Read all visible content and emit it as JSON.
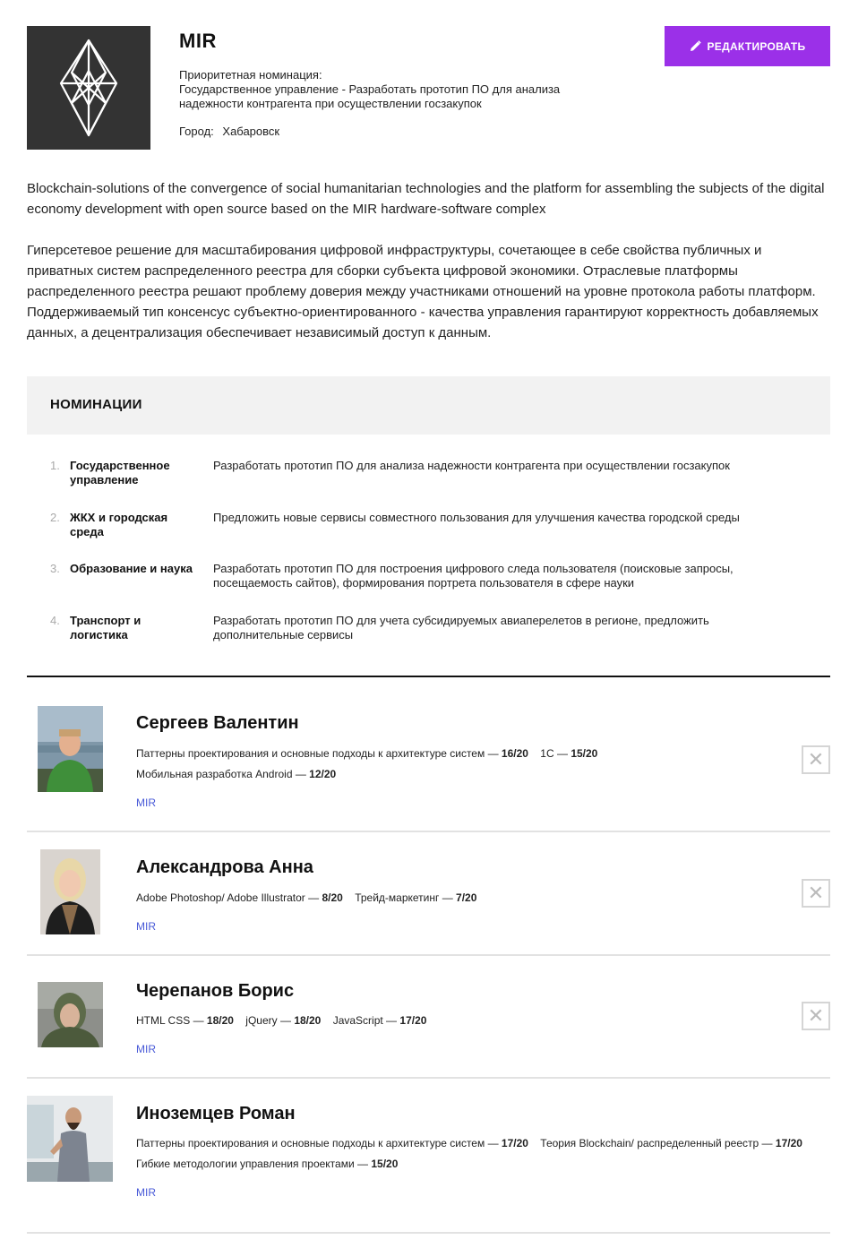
{
  "team": {
    "name": "MIR",
    "priority_label": "Приоритетная номинация:",
    "priority_value": "Государственное управление - Разработать прототип ПО для анализа надежности контрагента при осуществлении госзакупок",
    "city_label": "Город:",
    "city_value": "Хабаровск",
    "edit_label": "РЕДАКТИРОВАТЬ"
  },
  "description": {
    "en": "Blockchain-solutions of the convergence of social humanitarian technologies and the platform for assembling the subjects of the digital economy development with open source based on the MIR hardware-software complex",
    "ru": "Гиперсетевое решение для масштабирования цифровой инфраструктуры, сочетающее в себе свойства публичных и приватных систем распределенного реестра для сборки субъекта цифровой экономики. Отраслевые платформы распределенного реестра решают проблему доверия между участниками отношений на уровне протокола работы платформ. Поддерживаемый тип консенсус субъектно-ориентированного - качества управления гарантируют корректность добавляемых данных, а децентрализация обеспечивает независимый доступ к данным."
  },
  "nominations": {
    "title": "НОМИНАЦИИ",
    "items": [
      {
        "num": "1.",
        "category": "Государственное управление",
        "task": "Разработать прототип ПО для анализа надежности контрагента при осуществлении госзакупок"
      },
      {
        "num": "2.",
        "category": "ЖКХ и городская среда",
        "task": "Предложить новые сервисы совместного пользования для улучшения качества городской среды"
      },
      {
        "num": "3.",
        "category": "Образование и наука",
        "task": "Разработать прототип ПО для построения цифрового следа пользователя (поисковые запросы, посещаемость сайтов), формирования портрета пользователя в сфере науки"
      },
      {
        "num": "4.",
        "category": "Транспорт и логистика",
        "task": "Разработать прототип ПО для учета субсидируемых авиаперелетов в регионе, предложить дополнительные сервисы"
      }
    ]
  },
  "members": [
    {
      "name": "Сергеев Валентин",
      "skill_lines": [
        [
          {
            "name": "Паттерны проектирования и основные подходы к архитектуре систем —",
            "score": "16/20"
          },
          {
            "name": "1С —",
            "score": "15/20"
          }
        ],
        [
          {
            "name": "Мобильная разработка Android —",
            "score": "12/20"
          }
        ]
      ],
      "team": "MIR",
      "removable": true
    },
    {
      "name": "Александрова Анна",
      "skill_lines": [
        [
          {
            "name": "Adobe Photoshop/ Adobe Illustrator —",
            "score": "8/20"
          },
          {
            "name": "Трейд-маркетинг —",
            "score": "7/20"
          }
        ]
      ],
      "team": "MIR",
      "removable": true
    },
    {
      "name": "Черепанов Борис",
      "skill_lines": [
        [
          {
            "name": "HTML CSS —",
            "score": "18/20"
          },
          {
            "name": "jQuery —",
            "score": "18/20"
          },
          {
            "name": "JavaScript —",
            "score": "17/20"
          }
        ]
      ],
      "team": "MIR",
      "removable": true
    },
    {
      "name": "Иноземцев Роман",
      "skill_lines": [
        [
          {
            "name": "Паттерны проектирования и основные подходы к архитектуре систем —",
            "score": "17/20"
          },
          {
            "name": "Теория Blockchain/ распределенный реестр —",
            "score": "17/20"
          }
        ],
        [
          {
            "name": "Гибкие методологии управления проектами —",
            "score": "15/20"
          }
        ]
      ],
      "team": "MIR",
      "removable": false
    }
  ],
  "icons": {
    "logo": "crystal-logo-icon",
    "edit": "pencil-icon",
    "remove": "close-icon"
  },
  "colors": {
    "accent": "#9b30e8",
    "link": "#4a5bd8",
    "logo_bg": "#333333"
  }
}
